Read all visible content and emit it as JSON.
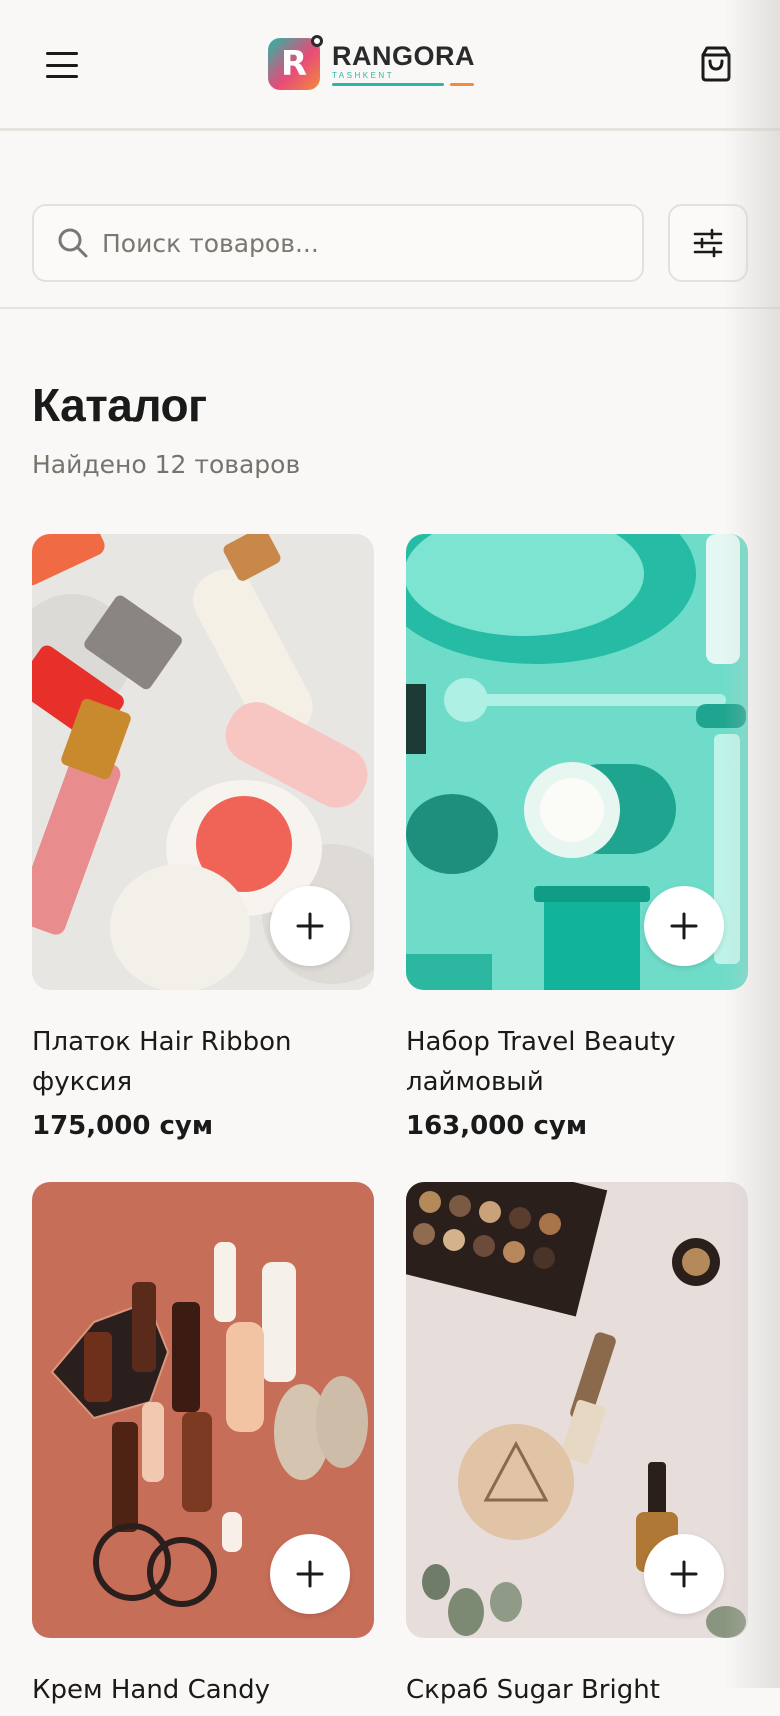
{
  "header": {
    "logo_name": "RANGORA",
    "logo_sub": "TASHKENT",
    "logo_letter": "R",
    "menu_icon": "hamburger-menu-icon",
    "cart_icon": "shopping-bag-icon"
  },
  "search": {
    "placeholder": "Поиск товаров...",
    "value": "",
    "icon": "search-icon",
    "filter_icon": "sliders-filter-icon"
  },
  "catalog": {
    "title": "Каталог",
    "count_text": "Найдено 12 товаров"
  },
  "products": [
    {
      "name": "Платок Hair Ribbon фуксия",
      "price": "175,000 сум",
      "image": "lipstick-blush-flatlay"
    },
    {
      "name": "Набор Travel Beauty лаймовый",
      "price": "163,000 сум",
      "image": "teal-beauty-tools-flatlay"
    },
    {
      "name": "Крем Hand Candy",
      "price": "",
      "image": "terracotta-bottles-flatlay"
    },
    {
      "name": "Скраб Sugar Bright",
      "price": "",
      "image": "eyeshadow-palette-flatlay"
    }
  ],
  "colors": {
    "accent_teal": "#27b7a6",
    "accent_orange": "#f28b3b",
    "background": "#f9f8f6",
    "text": "#1a1a1a",
    "muted": "#77736c"
  }
}
